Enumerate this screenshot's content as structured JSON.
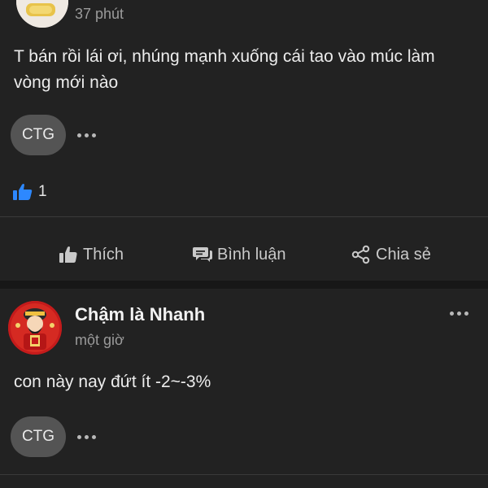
{
  "post1": {
    "time": "37 phút",
    "text": "T bán rồi lái ơi, nhúng mạnh xuống cái tao vào múc làm vòng mới nào",
    "tag": "CTG",
    "reaction_count": "1"
  },
  "actions": {
    "like": "Thích",
    "comment": "Bình luận",
    "share": "Chia sẻ"
  },
  "post2": {
    "author": "Chậm là Nhanh",
    "time": "một giờ",
    "text": "con này nay đứt ít -2~-3%",
    "tag": "CTG"
  },
  "colors": {
    "background": "#171717",
    "card": "#222222",
    "tag_bg": "#545454",
    "like_blue": "#2d88ff"
  }
}
